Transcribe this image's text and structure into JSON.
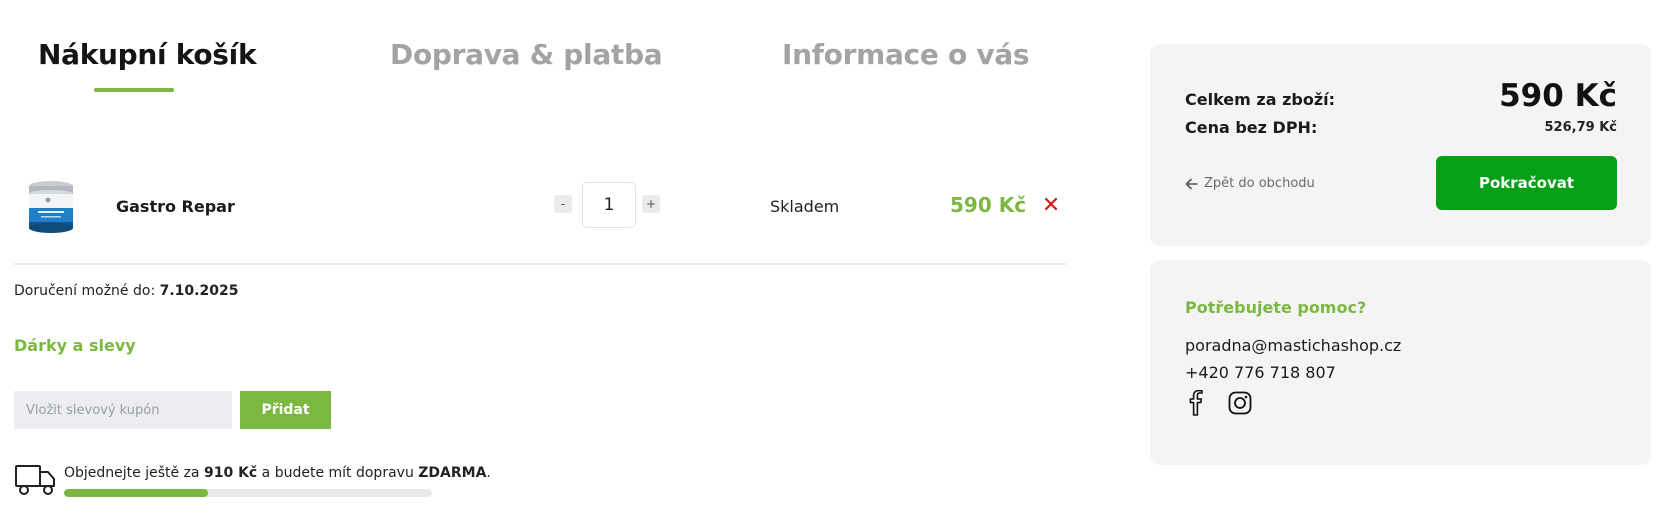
{
  "steps": [
    {
      "label": "Nákupní košík",
      "state": "active"
    },
    {
      "label": "Doprava & platba",
      "state": "inactive"
    },
    {
      "label": "Informace o vás",
      "state": "inactive"
    }
  ],
  "cart": {
    "items": [
      {
        "name": "Gastro Repar",
        "quantity": "1",
        "qty_minus": "-",
        "qty_plus": "+",
        "availability": "Skladem",
        "price": "590 Kč",
        "remove_icon": "close-icon"
      }
    ]
  },
  "delivery": {
    "label": "Doručení možné do:",
    "date": "7.10.2025"
  },
  "gifts": {
    "title": "Dárky a slevy",
    "coupon_placeholder": "Vložit slevový kupón",
    "coupon_button": "Přidat"
  },
  "shipping": {
    "text_before": "Objednejte ještě za",
    "remaining": "910 Kč",
    "text_middle": "a budete mít dopravu",
    "free_label": "ZDARMA",
    "text_end": ".",
    "progress_percent": 39
  },
  "summary": {
    "total_label": "Celkem za zboží:",
    "total_value": "590 Kč",
    "net_label": "Cena bez DPH:",
    "net_value": "526,79 Kč",
    "back_link": "Zpět do obchodu",
    "continue_button": "Pokračovat"
  },
  "help": {
    "title": "Potřebujete pomoc?",
    "email": "poradna@mastichashop.cz",
    "phone": "+420 776 718 807"
  },
  "colors": {
    "accent_green": "#7bb842",
    "button_green": "#05a018",
    "remove_red": "#d01c1c",
    "panel_bg": "#f4f4f4"
  }
}
